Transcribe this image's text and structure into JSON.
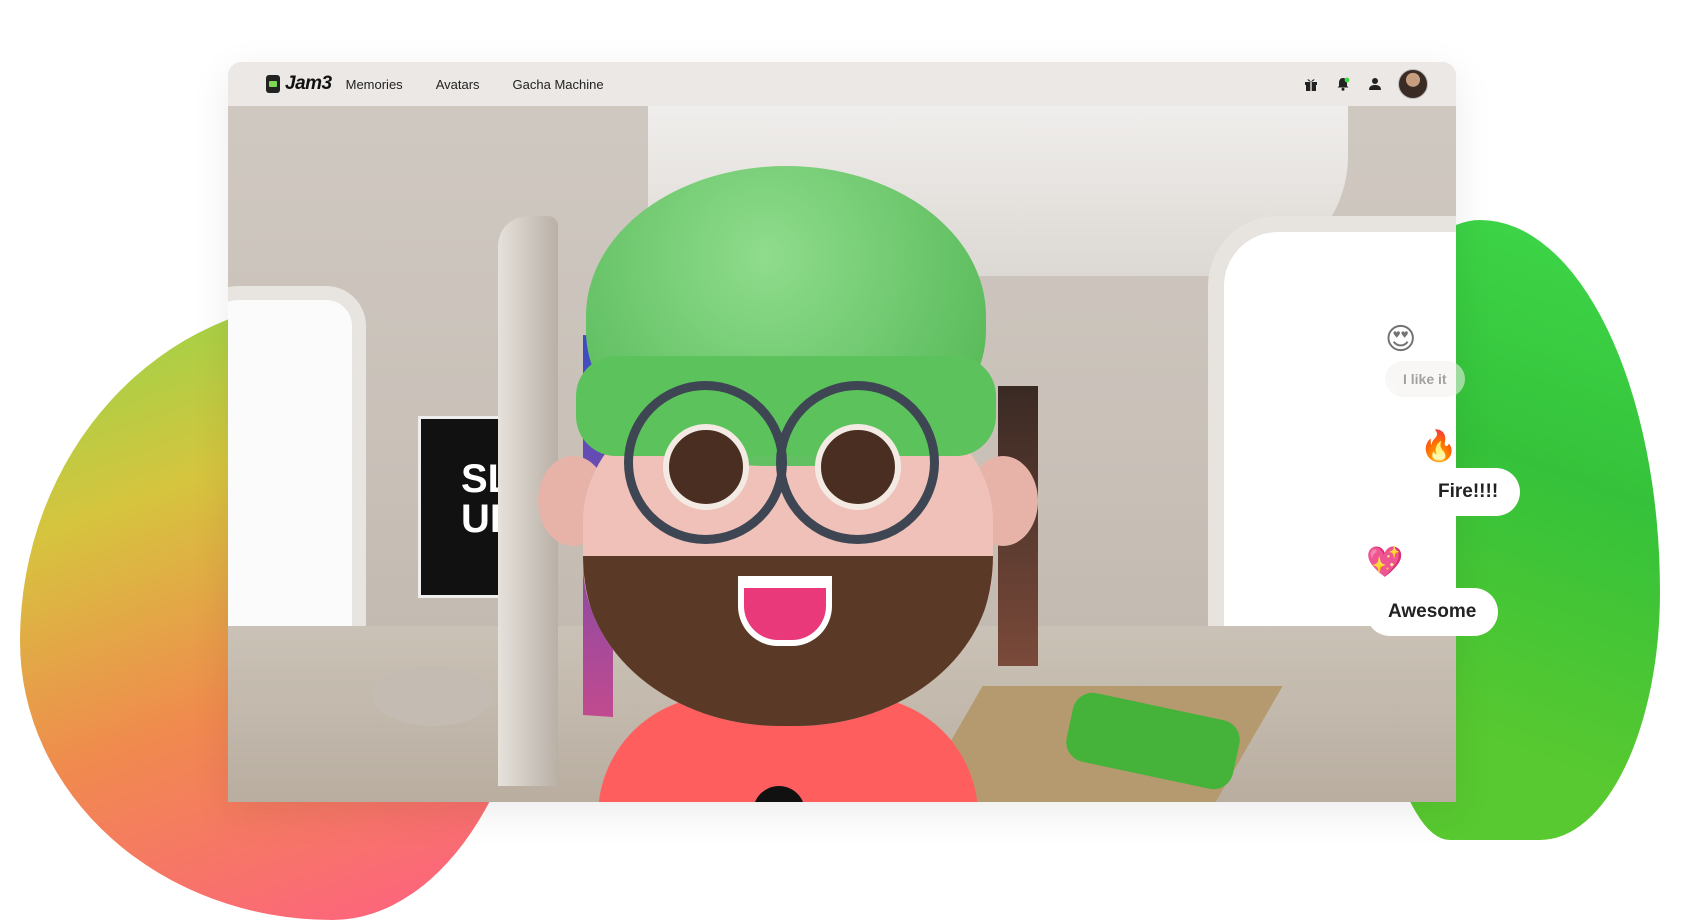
{
  "app": {
    "logo_text": "Jam3"
  },
  "nav": {
    "items": [
      {
        "label": "Memories"
      },
      {
        "label": "Avatars"
      },
      {
        "label": "Gacha Machine"
      }
    ]
  },
  "header_icons": [
    "gift-icon",
    "bell-icon",
    "user-icon",
    "avatar"
  ],
  "colors": {
    "hat": "#5cc25b",
    "shirt": "#ff5e5e",
    "accent_green": "#3fd84a"
  },
  "poster": {
    "text": "SL UKI"
  },
  "reactions": [
    {
      "emoji": "😍",
      "text": "I like it"
    },
    {
      "emoji": "🔥",
      "text": "Fire!!!!"
    },
    {
      "emoji": "💖",
      "text": "Awesome"
    }
  ]
}
